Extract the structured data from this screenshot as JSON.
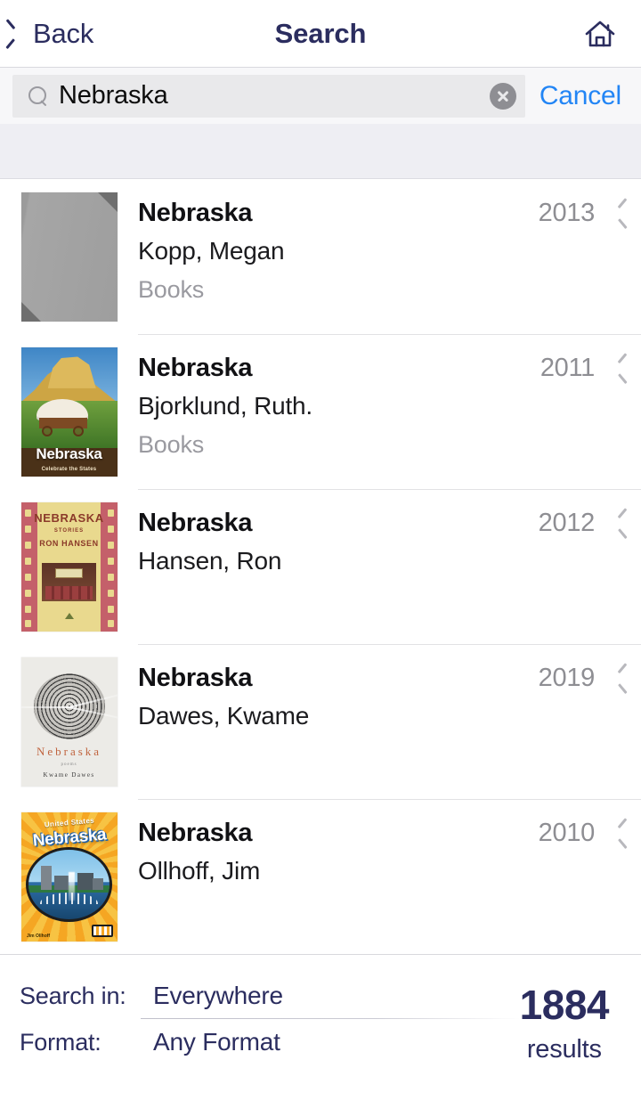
{
  "navbar": {
    "back_label": "Back",
    "title": "Search",
    "back_icon": "chevron-left-icon",
    "home_icon": "home-icon"
  },
  "search": {
    "value": "Nebraska",
    "placeholder": "Search",
    "search_icon": "search-icon",
    "clear_icon": "clear-circle-icon",
    "cancel_label": "Cancel",
    "accent_cancel": "#2285f5"
  },
  "results": [
    {
      "title": "Nebraska",
      "author": "Kopp, Megan",
      "format": "Books",
      "year": "2013",
      "cover": {
        "kind": "placeholder",
        "alt": "no-cover-placeholder"
      }
    },
    {
      "title": "Nebraska",
      "author": "Bjorklund, Ruth.",
      "format": "Books",
      "year": "2011",
      "cover": {
        "kind": "wagon",
        "cover_title": "Nebraska",
        "cover_subtitle": "Celebrate the States"
      }
    },
    {
      "title": "Nebraska",
      "author": "Hansen, Ron",
      "format": "",
      "year": "2012",
      "cover": {
        "kind": "film",
        "cover_title": "NEBRASKA",
        "cover_subtitle": "STORIES",
        "cover_author": "RON HANSEN"
      }
    },
    {
      "title": "Nebraska",
      "author": "Dawes, Kwame",
      "format": "",
      "year": "2019",
      "cover": {
        "kind": "rings",
        "cover_title": "Nebraska",
        "cover_subtitle": "poems",
        "cover_author": "Kwame Dawes"
      }
    },
    {
      "title": "Nebraska",
      "author": "Ollhoff, Jim",
      "format": "",
      "year": "2010",
      "cover": {
        "kind": "burst",
        "cover_kicker": "United States",
        "cover_title": "Nebraska",
        "cover_author": "Jim Ollhoff"
      }
    }
  ],
  "footer": {
    "search_in_label": "Search in:",
    "search_in_value": "Everywhere",
    "format_label": "Format:",
    "format_value": "Any Format",
    "result_count": "1884",
    "result_count_label": "results",
    "navy": "#2b2d5f"
  }
}
